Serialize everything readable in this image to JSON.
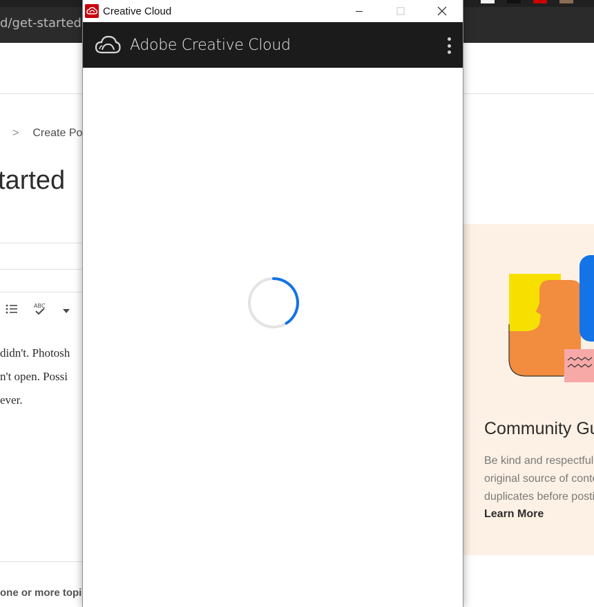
{
  "browser": {
    "url_fragment": "d/get-started"
  },
  "background_page": {
    "breadcrumb": {
      "separator": ">",
      "current": "Create Pos"
    },
    "heading": "tarted",
    "editor_text_lines": [
      "didn't.  Photosh",
      "n't open.  Possi",
      "ever."
    ],
    "topics_text": "one or more topi",
    "guidelines": {
      "title": "Community Gu",
      "body_lines": [
        "Be kind and respectful,",
        "original source of conte",
        "duplicates before posti"
      ],
      "link_label": "Learn More"
    }
  },
  "window": {
    "title": "Creative Cloud",
    "header_title": "Adobe Creative Cloud",
    "state": "loading"
  },
  "colors": {
    "header_bg": "#1b1b1b",
    "spinner_accent": "#1473e6",
    "app_icon_red": "#c8000b",
    "guidelines_bg": "#fdf1e5"
  },
  "icons": {
    "app_icon": "creative-cloud-app-icon",
    "logo": "creative-cloud-logo-icon",
    "menu": "more-vertical-icon"
  }
}
